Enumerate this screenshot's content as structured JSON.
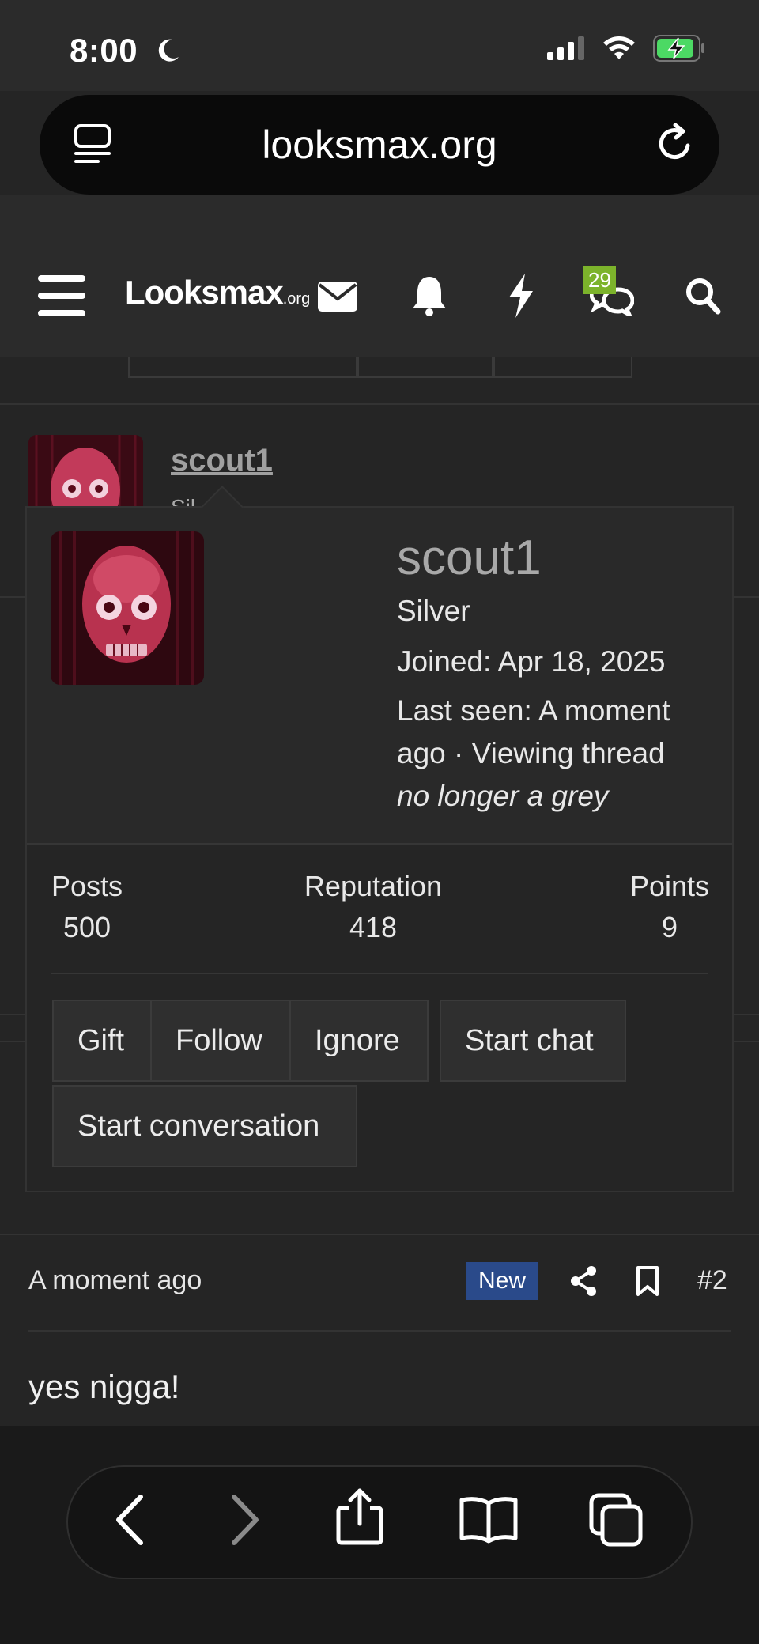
{
  "status_bar": {
    "time": "8:00"
  },
  "browser": {
    "url": "looksmax.org"
  },
  "site": {
    "logo_main": "Looksmax",
    "logo_suffix": ".org",
    "chat_badge": "29"
  },
  "post_header": {
    "username": "scout1",
    "rank_partial": "Sil"
  },
  "profile_card": {
    "username": "scout1",
    "rank": "Silver",
    "joined": "Joined: Apr 18, 2025",
    "last_seen_line1": "Last seen: A moment",
    "last_seen_line2": "ago · Viewing thread",
    "custom_title": "no longer a grey",
    "stats": [
      {
        "label": "Posts",
        "value": "500"
      },
      {
        "label": "Reputation",
        "value": "418"
      },
      {
        "label": "Points",
        "value": "9"
      }
    ],
    "buttons": {
      "gift": "Gift",
      "follow": "Follow",
      "ignore": "Ignore",
      "start_chat": "Start chat",
      "start_conversation": "Start conversation"
    }
  },
  "post": {
    "time": "A moment ago",
    "new_badge": "New",
    "number": "#2",
    "body": "yes nigga!"
  },
  "colors": {
    "background": "#252525",
    "nav_background": "#2b2b2b",
    "badge_green": "#7cb32b",
    "new_badge_blue": "#2a4a8a"
  }
}
